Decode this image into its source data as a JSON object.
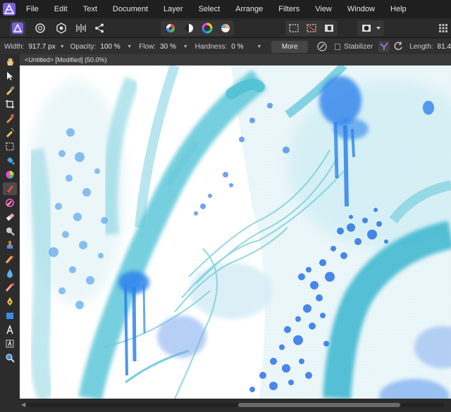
{
  "menu": [
    "File",
    "Edit",
    "Text",
    "Document",
    "Layer",
    "Select",
    "Arrange",
    "Filters",
    "View",
    "Window",
    "Help"
  ],
  "toolbar": {
    "personas": [
      "affinity-photo-logo",
      "photo-persona-icon",
      "liquify-persona-icon",
      "develop-persona-icon",
      "export-persona-icon"
    ],
    "studio_icons": [
      "histogram-icon",
      "contrast-icon",
      "color-wheel-icon",
      "white-balance-icon"
    ],
    "selection_icons": [
      "marquee-icon",
      "no-marquee-icon",
      "invert-selection-icon"
    ],
    "mask_icons": [
      "quick-mask-icon"
    ]
  },
  "context": {
    "width_label": "Width:",
    "width_value": "917.7 px",
    "opacity_label": "Opacity:",
    "opacity_value": "100 %",
    "flow_label": "Flow:",
    "flow_value": "30 %",
    "hardness_label": "Hardness:",
    "hardness_value": "0 %",
    "more_label": "More",
    "stabilizer_label": "Stabilizer",
    "length_label": "Length:",
    "length_value": "81.4"
  },
  "document": {
    "tab_title": "<Untitled> [Modified] (50.0%)"
  },
  "tools": [
    "hand-tool-icon",
    "move-tool-icon",
    "color-picker-tool-icon",
    "crop-tool-icon",
    "paint-mixer-tool-icon",
    "selection-brush-tool-icon",
    "marquee-tool-icon",
    "flood-fill-tool-icon",
    "color-replace-tool-icon",
    "paint-brush-tool-icon",
    "pixel-tool-icon",
    "eraser-tool-icon",
    "dodge-tool-icon",
    "clone-tool-icon",
    "healing-tool-icon",
    "blur-tool-icon",
    "red-eye-tool-icon",
    "pen-tool-icon",
    "rectangle-tool-icon",
    "text-tool-icon",
    "frame-text-tool-icon",
    "zoom-tool-icon"
  ],
  "colors": {
    "accent": "#8f6ce6",
    "paint_light": "#5bc8d8",
    "paint_mid": "#2ea9c9",
    "paint_blue": "#2d7ce8"
  }
}
